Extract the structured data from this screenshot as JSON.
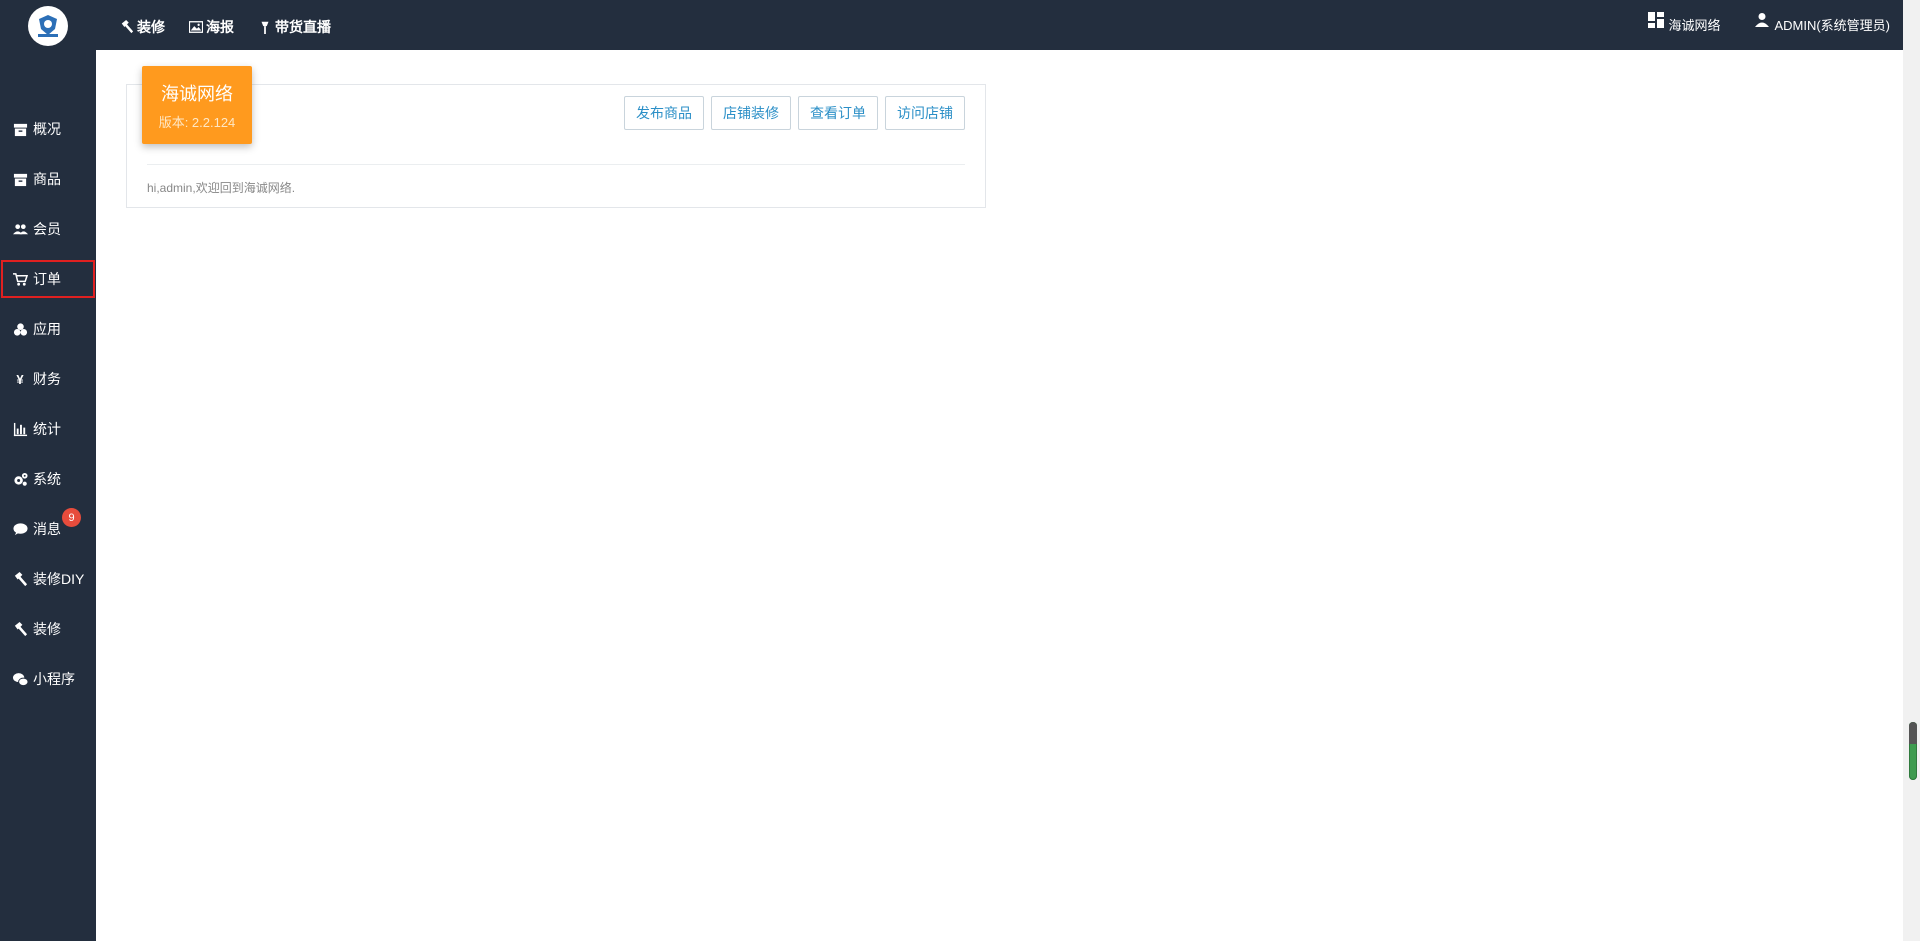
{
  "sidebar": {
    "items": [
      {
        "label": "概况",
        "icon": "archive-icon"
      },
      {
        "label": "商品",
        "icon": "box-icon"
      },
      {
        "label": "会员",
        "icon": "users-icon"
      },
      {
        "label": "订单",
        "icon": "cart-icon",
        "active": true
      },
      {
        "label": "应用",
        "icon": "cubes-icon"
      },
      {
        "label": "财务",
        "icon": "yen-icon"
      },
      {
        "label": "统计",
        "icon": "bar-chart-icon"
      },
      {
        "label": "系统",
        "icon": "cogs-icon"
      },
      {
        "label": "消息",
        "icon": "comment-icon",
        "badge": "9"
      },
      {
        "label": "装修DIY",
        "icon": "hammer-icon"
      },
      {
        "label": "装修",
        "icon": "hammer-icon"
      },
      {
        "label": "小程序",
        "icon": "wechat-icon"
      }
    ]
  },
  "topbar": {
    "links": [
      {
        "label": "装修",
        "icon": "hammer-icon"
      },
      {
        "label": "海报",
        "icon": "image-icon"
      },
      {
        "label": "带货直播",
        "icon": "torch-icon"
      }
    ],
    "shop_label": "海诚网络",
    "user_label": "ADMIN(系统管理员)"
  },
  "dashboard": {
    "brand_name": "海诚网络",
    "version": "版本: 2.2.124",
    "buttons": [
      "发布商品",
      "店铺装修",
      "查看订单",
      "访问店铺"
    ],
    "welcome": "hi,admin,欢迎回到海诚网络."
  },
  "colors": {
    "sidebar_bg": "#232e3e",
    "brand_card": "#ff9a1e",
    "active_outline": "#e02020",
    "badge": "#e74c3c",
    "button_text": "#2b8fc7"
  }
}
